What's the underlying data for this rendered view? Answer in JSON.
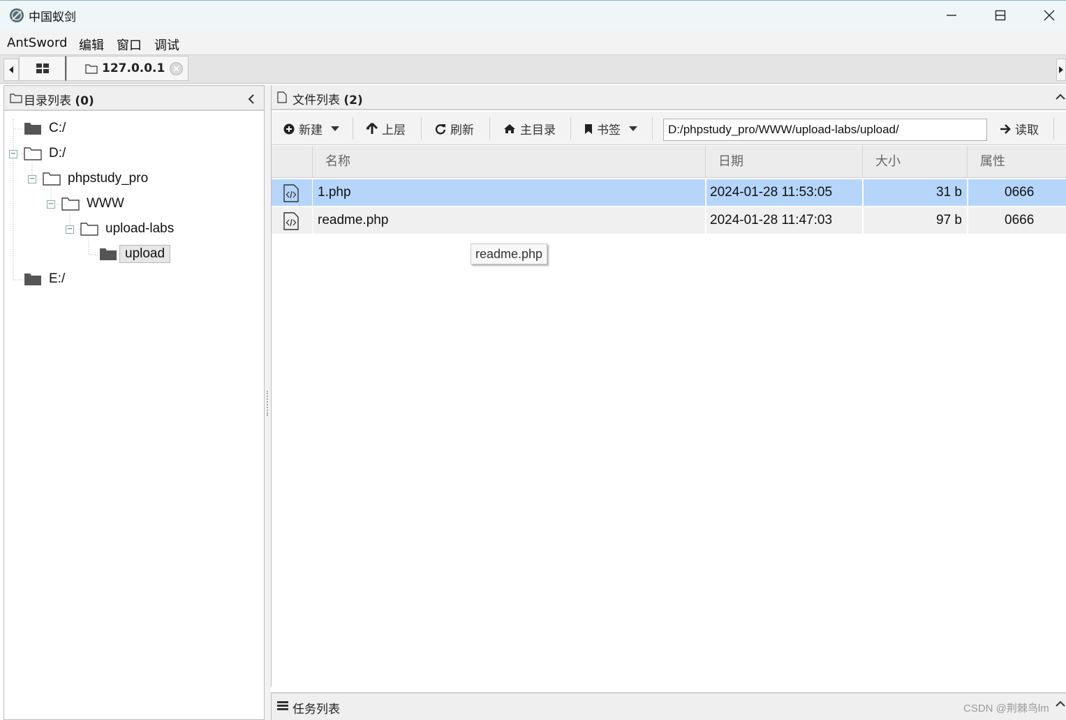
{
  "window": {
    "title": "中国蚁剑",
    "icon": "antsword-logo-icon"
  },
  "menubar": {
    "items": [
      "AntSword",
      "编辑",
      "窗口",
      "调试"
    ]
  },
  "tabs": {
    "host_label": "127.0.0.1",
    "icons": [
      "grid-icon",
      "folder-icon",
      "close-icon"
    ]
  },
  "left_panel": {
    "title": "目录列表",
    "count": "(0)",
    "tree": {
      "c_drive": "C:/",
      "d_drive": "D:/",
      "phpstudy": "phpstudy_pro",
      "www": "WWW",
      "upload_labs": "upload-labs",
      "upload": "upload",
      "e_drive": "E:/"
    }
  },
  "right_panel": {
    "title": "文件列表",
    "count": "(2)",
    "toolbar": {
      "new_label": "新建",
      "up_label": "上层",
      "refresh_label": "刷新",
      "home_label": "主目录",
      "bookmark_label": "书签",
      "read_label": "读取",
      "path_value": "D:/phpstudy_pro/WWW/upload-labs/upload/"
    },
    "columns": {
      "name": "名称",
      "date": "日期",
      "size": "大小",
      "attr": "属性"
    },
    "files": [
      {
        "name": "1.php",
        "date": "2024-01-28 11:53:05",
        "size": "31 b",
        "attr": "0666",
        "selected": true
      },
      {
        "name": "readme.php",
        "date": "2024-01-28 11:47:03",
        "size": "97 b",
        "attr": "0666",
        "selected": false
      }
    ],
    "tooltip": "readme.php"
  },
  "task_panel": {
    "title": "任务列表"
  },
  "watermark": "CSDN @荆棘鸟lm",
  "colors": {
    "selected_row": "#b5d5fb",
    "titlebar": "#eef6f8"
  }
}
